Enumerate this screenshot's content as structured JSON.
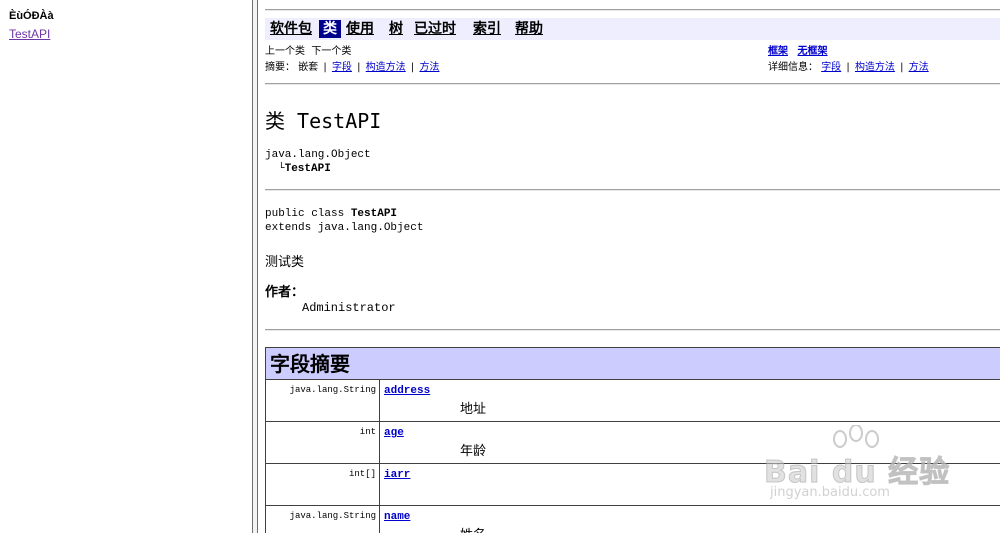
{
  "left_frame": {
    "title": "ÈùÓÐÀà",
    "class_link": "TestAPI"
  },
  "navbar": {
    "items": [
      {
        "label": "软件包",
        "active": false
      },
      {
        "label": "类",
        "active": true
      },
      {
        "label": "使用",
        "active": false
      },
      {
        "label": "树",
        "active": false
      },
      {
        "label": "已过时",
        "active": false
      },
      {
        "label": "索引",
        "active": false
      },
      {
        "label": "帮助",
        "active": false
      }
    ]
  },
  "subnav": {
    "prev_class": "上一个类",
    "next_class": "下一个类",
    "frames": "框架",
    "no_frames": "无框架",
    "summary_label": "摘要：",
    "summary_nested": "嵌套",
    "summary_field": "字段",
    "summary_constructor": "构造方法",
    "summary_method": "方法",
    "separator": "|",
    "detail_label": "详细信息：",
    "detail_field": "字段",
    "detail_constructor": "构造方法",
    "detail_method": "方法"
  },
  "class": {
    "title": "类 TestAPI",
    "hierarchy_parent": "java.lang.Object",
    "hierarchy_branch": "└",
    "hierarchy_child": "TestAPI",
    "decl_prefix": "public class ",
    "decl_name": "TestAPI",
    "decl_extends": "extends java.lang.Object",
    "description": "测试类",
    "author_label": "作者：",
    "author": "Administrator"
  },
  "field_summary": {
    "heading": "字段摘要",
    "rows": [
      {
        "type": "java.lang.String",
        "name": "address",
        "desc": "地址"
      },
      {
        "type": "int",
        "name": "age",
        "desc": "年龄"
      },
      {
        "type": "int[]",
        "name": "iarr",
        "desc": ""
      },
      {
        "type": "java.lang.String",
        "name": "name",
        "desc": "姓名"
      }
    ]
  },
  "watermark": {
    "brand": "Bai du 经验",
    "url": "jingyan.baidu.com"
  },
  "colors": {
    "navbar_bg": "#eeeeff",
    "nav_active_bg": "#00008b",
    "table_header_bg": "#ccccff",
    "link": "#0000cc",
    "visited_link": "#6e35a7"
  }
}
